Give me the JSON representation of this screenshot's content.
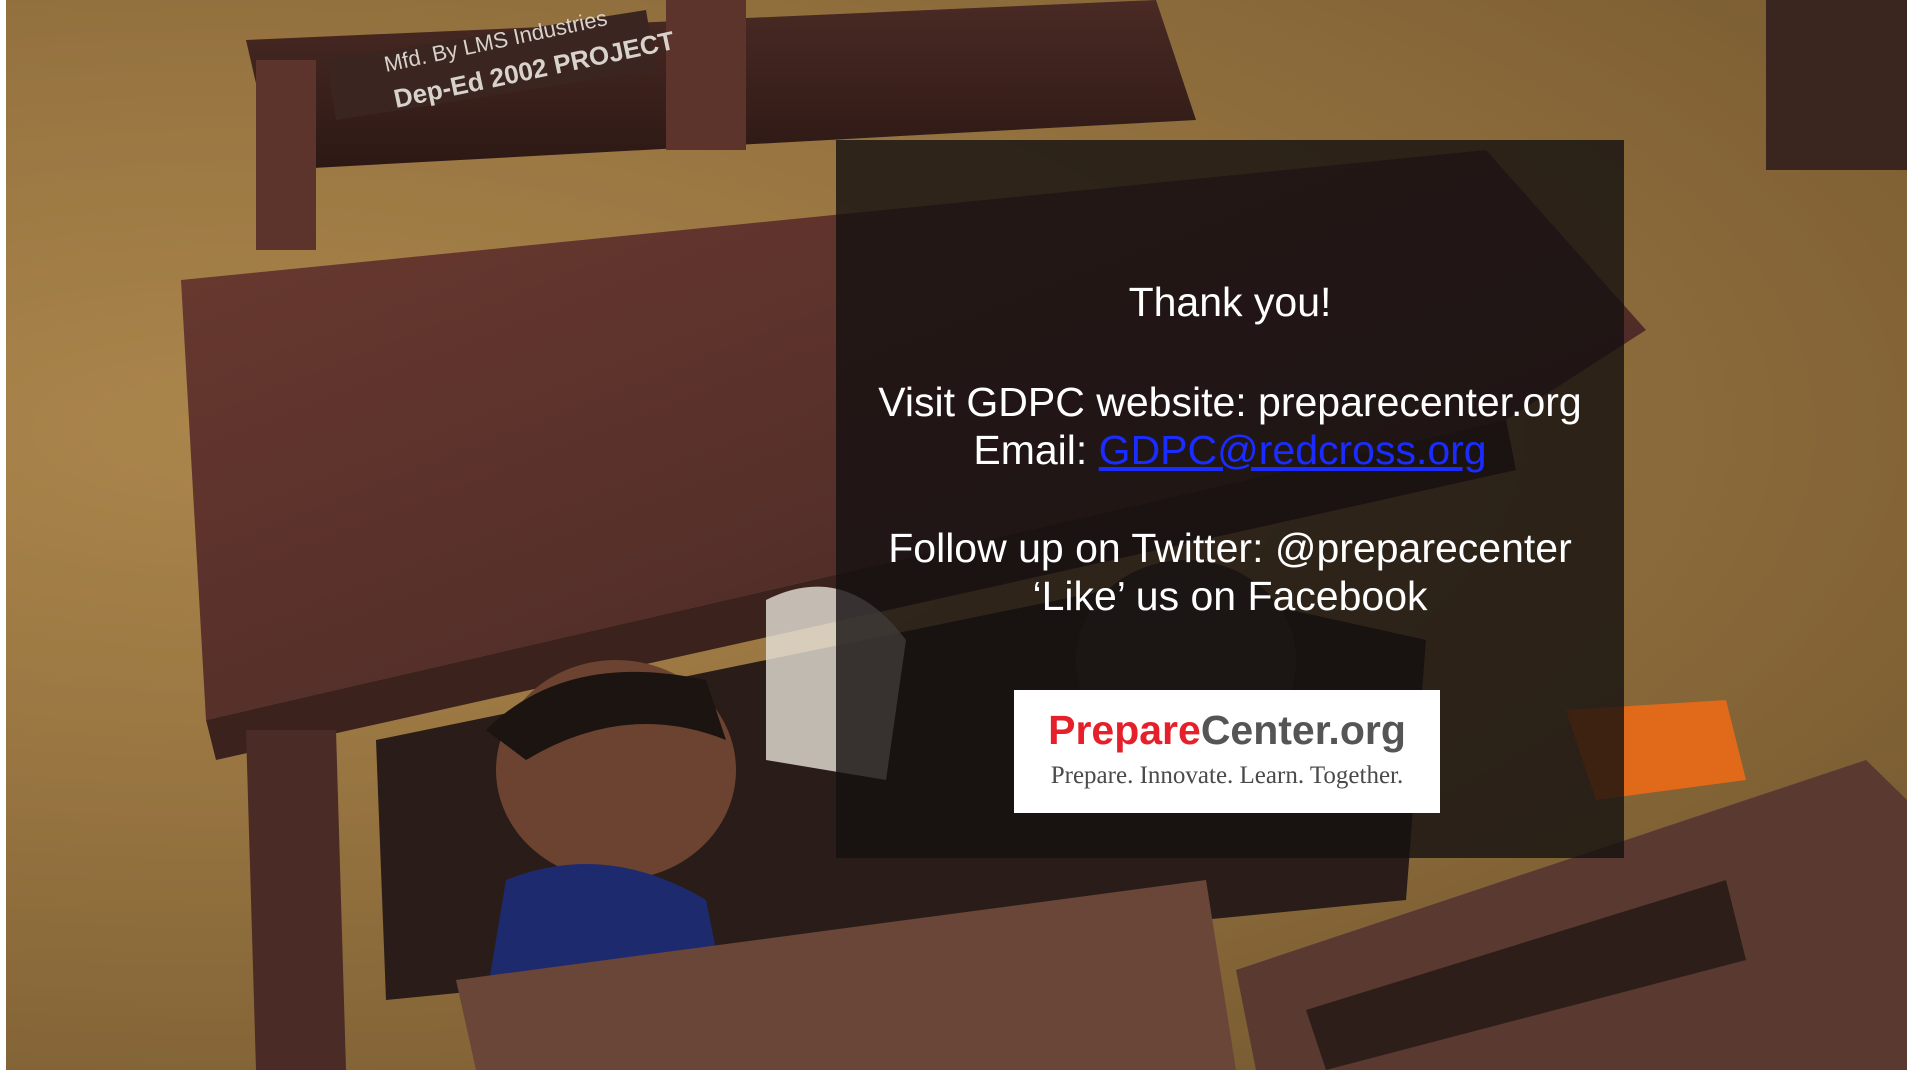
{
  "colors": {
    "overlay": "#141010",
    "text": "#ffffff",
    "link": "#1a2cff",
    "logo_red": "#e5202a",
    "logo_gray": "#555555",
    "desk_wood": "#5a2f27",
    "floor": "#9a7742"
  },
  "photo": {
    "desk_stamp_line1": "Mfd. By LMS Industries",
    "desk_stamp_line2": "Dep-Ed 2002 PROJECT"
  },
  "message": {
    "thank_you": "Thank you!",
    "website_line": "Visit GDPC website: preparecenter.org",
    "email_label": "Email: ",
    "email_link": "GDPC@redcross.org",
    "twitter_line": "Follow up on Twitter: @preparecenter",
    "facebook_line": "‘Like’ us on Facebook"
  },
  "logo": {
    "word_red": "Prepare",
    "word_gray": "Center.org",
    "tagline": "Prepare. Innovate. Learn. Together."
  }
}
